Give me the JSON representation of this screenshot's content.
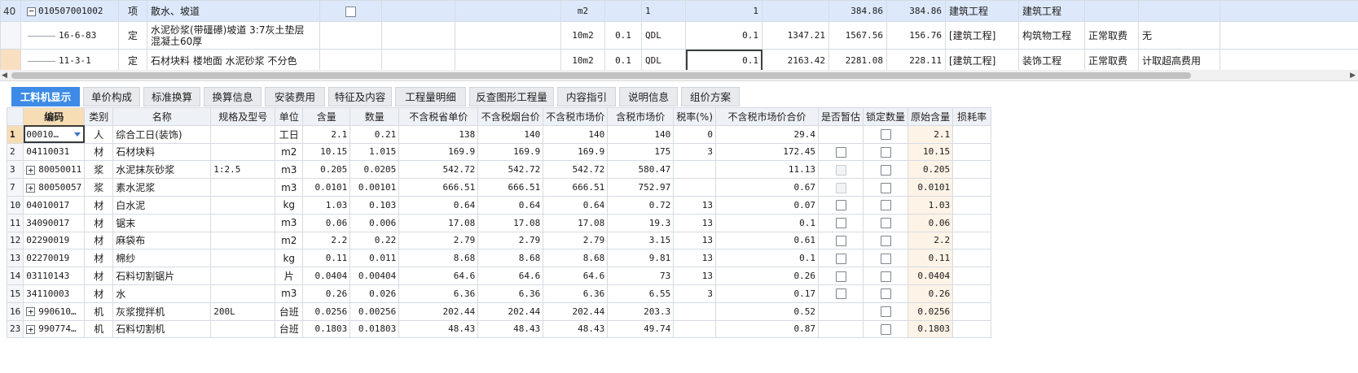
{
  "top_rows": [
    {
      "num": "40",
      "code": "010507001002",
      "type": "项",
      "name": "散水、坡道",
      "unit": "m2",
      "content": "",
      "qty_expr": "1",
      "qty": "1",
      "col1": "",
      "col2": "384.86",
      "col3": "384.86",
      "major": "建筑工程",
      "specialty": "建筑工程",
      "fee": "",
      "extra": ""
    },
    {
      "num": "",
      "code": "16-6-83",
      "type": "定",
      "name": "水泥砂浆(带礓礤)坡道 3:7灰土垫层 混凝土60厚",
      "unit": "10m2",
      "content": "0.1",
      "qty_expr": "QDL",
      "qty": "0.1",
      "col1": "1347.21",
      "col2": "1567.56",
      "col3": "156.76",
      "major": "[建筑工程]",
      "specialty": "构筑物工程",
      "fee": "正常取费",
      "extra": "无"
    },
    {
      "num": "",
      "code": "11-3-1",
      "type": "定",
      "name": "石材块料 楼地面 水泥砂浆 不分色",
      "unit": "10m2",
      "content": "0.1",
      "qty_expr": "QDL",
      "qty": "0.1",
      "col1": "2163.42",
      "col2": "2281.08",
      "col3": "228.11",
      "major": "[建筑工程]",
      "specialty": "装饰工程",
      "fee": "正常取费",
      "extra": "计取超高费用"
    }
  ],
  "tabs": [
    "工料机显示",
    "单价构成",
    "标准换算",
    "换算信息",
    "安装费用",
    "特征及内容",
    "工程量明细",
    "反查图形工程量",
    "内容指引",
    "说明信息",
    "组价方案"
  ],
  "headers": [
    "编码",
    "类别",
    "名称",
    "规格及型号",
    "单位",
    "含量",
    "数量",
    "不含税省单价",
    "不含税烟台价",
    "不含税市场价",
    "含税市场价",
    "税率(%)",
    "不含税市场价合价",
    "是否暂估",
    "锁定数量",
    "原始含量",
    "损耗率"
  ],
  "rows": [
    {
      "rn": "1",
      "code": "00010…",
      "expand": false,
      "cat": "人",
      "name": "综合工日(装饰)",
      "spec": "",
      "unit": "工日",
      "content": "2.1",
      "qty": "0.21",
      "p1": "138",
      "p2": "140",
      "p3": "140",
      "p4": "140",
      "tax": "0",
      "total": "29.4",
      "est": "none",
      "lock": true,
      "orig": "2.1"
    },
    {
      "rn": "2",
      "code": "04110031",
      "expand": false,
      "cat": "材",
      "name": "石材块料",
      "spec": "",
      "unit": "m2",
      "content": "10.15",
      "qty": "1.015",
      "p1": "169.9",
      "p2": "169.9",
      "p3": "169.9",
      "p4": "175",
      "tax": "3",
      "total": "172.45",
      "est": "box",
      "lock": true,
      "orig": "10.15"
    },
    {
      "rn": "3",
      "code": "80050011",
      "expand": true,
      "cat": "浆",
      "name": "水泥抹灰砂浆",
      "spec": "1:2.5",
      "unit": "m3",
      "content": "0.205",
      "qty": "0.0205",
      "p1": "542.72",
      "p2": "542.72",
      "p3": "542.72",
      "p4": "580.47",
      "tax": "",
      "total": "11.13",
      "est": "disabled",
      "lock": true,
      "orig": "0.205"
    },
    {
      "rn": "7",
      "code": "80050057",
      "expand": true,
      "cat": "浆",
      "name": "素水泥浆",
      "spec": "",
      "unit": "m3",
      "content": "0.0101",
      "qty": "0.00101",
      "p1": "666.51",
      "p2": "666.51",
      "p3": "666.51",
      "p4": "752.97",
      "tax": "",
      "total": "0.67",
      "est": "disabled",
      "lock": true,
      "orig": "0.0101"
    },
    {
      "rn": "10",
      "code": "04010017",
      "expand": false,
      "cat": "材",
      "name": "白水泥",
      "spec": "",
      "unit": "kg",
      "content": "1.03",
      "qty": "0.103",
      "p1": "0.64",
      "p2": "0.64",
      "p3": "0.64",
      "p4": "0.72",
      "tax": "13",
      "total": "0.07",
      "est": "box",
      "lock": true,
      "orig": "1.03"
    },
    {
      "rn": "11",
      "code": "34090017",
      "expand": false,
      "cat": "材",
      "name": "锯末",
      "spec": "",
      "unit": "m3",
      "content": "0.06",
      "qty": "0.006",
      "p1": "17.08",
      "p2": "17.08",
      "p3": "17.08",
      "p4": "19.3",
      "tax": "13",
      "total": "0.1",
      "est": "box",
      "lock": true,
      "orig": "0.06"
    },
    {
      "rn": "12",
      "code": "02290019",
      "expand": false,
      "cat": "材",
      "name": "麻袋布",
      "spec": "",
      "unit": "m2",
      "content": "2.2",
      "qty": "0.22",
      "p1": "2.79",
      "p2": "2.79",
      "p3": "2.79",
      "p4": "3.15",
      "tax": "13",
      "total": "0.61",
      "est": "box",
      "lock": true,
      "orig": "2.2"
    },
    {
      "rn": "13",
      "code": "02270019",
      "expand": false,
      "cat": "材",
      "name": "棉纱",
      "spec": "",
      "unit": "kg",
      "content": "0.11",
      "qty": "0.011",
      "p1": "8.68",
      "p2": "8.68",
      "p3": "8.68",
      "p4": "9.81",
      "tax": "13",
      "total": "0.1",
      "est": "box",
      "lock": true,
      "orig": "0.11"
    },
    {
      "rn": "14",
      "code": "03110143",
      "expand": false,
      "cat": "材",
      "name": "石料切割锯片",
      "spec": "",
      "unit": "片",
      "content": "0.0404",
      "qty": "0.00404",
      "p1": "64.6",
      "p2": "64.6",
      "p3": "64.6",
      "p4": "73",
      "tax": "13",
      "total": "0.26",
      "est": "box",
      "lock": true,
      "orig": "0.0404"
    },
    {
      "rn": "15",
      "code": "34110003",
      "expand": false,
      "cat": "材",
      "name": "水",
      "spec": "",
      "unit": "m3",
      "content": "0.26",
      "qty": "0.026",
      "p1": "6.36",
      "p2": "6.36",
      "p3": "6.36",
      "p4": "6.55",
      "tax": "3",
      "total": "0.17",
      "est": "box",
      "lock": true,
      "orig": "0.26"
    },
    {
      "rn": "16",
      "code": "990610…",
      "expand": true,
      "cat": "机",
      "name": "灰浆搅拌机",
      "spec": "200L",
      "unit": "台班",
      "content": "0.0256",
      "qty": "0.00256",
      "p1": "202.44",
      "p2": "202.44",
      "p3": "202.44",
      "p4": "203.3",
      "tax": "",
      "total": "0.52",
      "est": "none",
      "lock": true,
      "orig": "0.0256"
    },
    {
      "rn": "23",
      "code": "990774…",
      "expand": true,
      "cat": "机",
      "name": "石料切割机",
      "spec": "",
      "unit": "台班",
      "content": "0.1803",
      "qty": "0.01803",
      "p1": "48.43",
      "p2": "48.43",
      "p3": "48.43",
      "p4": "49.74",
      "tax": "",
      "total": "0.87",
      "est": "none",
      "lock": true,
      "orig": "0.1803"
    }
  ]
}
